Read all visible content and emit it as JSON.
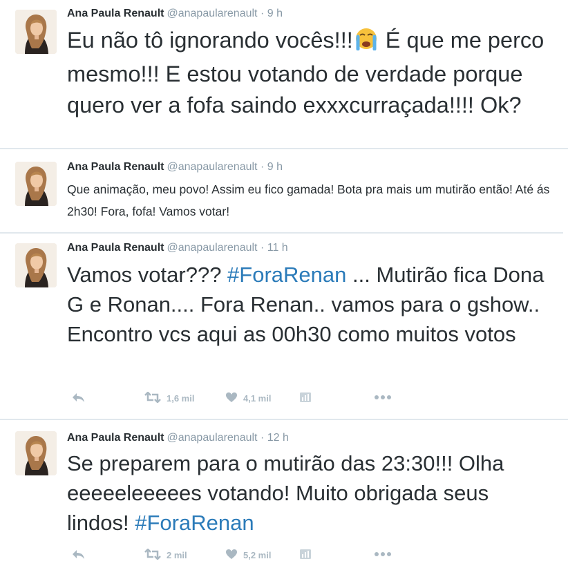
{
  "tweets": [
    {
      "name": "Ana Paula Renault",
      "handle": "@anapaularenault",
      "time": "· 9 h",
      "text_a": "Eu não tô ignorando vocês!!!",
      "emoji": "loudly-crying-face",
      "text_b": " É que me perco mesmo!!! E estou votando de verdade porque quero ver a fofa saindo exxxcurraçada!!!! Ok?"
    },
    {
      "name": "Ana Paula Renault",
      "handle": "@anapaularenault",
      "time": "· 9 h",
      "text": "Que animação, meu povo! Assim eu fico gamada! Bota pra mais um mutirão então! Até ás 2h30! Fora, fofa! Vamos votar!"
    },
    {
      "name": "Ana Paula Renault",
      "handle": "@anapaularenault",
      "time": "· 11 h",
      "text_a": "Vamos votar??? ",
      "hashtag": "#ForaRenan",
      "text_b": " ... Mutirão fica Dona G e Ronan.... Fora Renan.. vamos para o gshow.. Encontro vcs aqui as 00h30 como muitos votos",
      "retweets": "1,6 mil",
      "likes": "4,1 mil"
    },
    {
      "name": "Ana Paula Renault",
      "handle": "@anapaularenault",
      "time": "· 12 h",
      "text_a": "Se preparem para o mutirão das 23:30!!! Olha eeeeeleeeees votando! Muito obrigada seus lindos! ",
      "hashtag": "#ForaRenan",
      "retweets": "2 mil",
      "likes": "5,2 mil"
    }
  ],
  "colors": {
    "hashtag": "#2b7bb9",
    "muted": "#8899a6",
    "icon": "#aab8c2"
  },
  "icons": [
    "reply-icon",
    "retweet-icon",
    "heart-icon",
    "analytics-icon",
    "more-icon"
  ]
}
